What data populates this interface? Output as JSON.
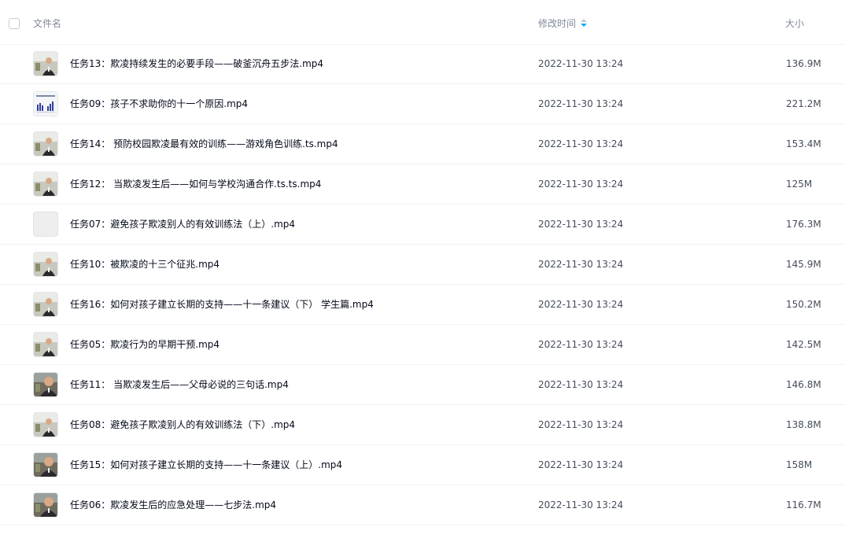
{
  "header": {
    "name_label": "文件名",
    "time_label": "修改时间",
    "size_label": "大小"
  },
  "colors": {
    "sort_active": "#06a7ff",
    "row_divider": "#f1f2f4",
    "header_text": "#818999"
  },
  "files": [
    {
      "name": "任务13：欺凌持续发生的必要手段——破釜沉舟五步法.mp4",
      "modified": "2022-11-30 13:24",
      "size": "136.9M",
      "thumb": "person-video-thumbnail"
    },
    {
      "name": "任务09：孩子不求助你的十一个原因.mp4",
      "modified": "2022-11-30 13:24",
      "size": "221.2M",
      "thumb": "bar-chart-video-thumbnail"
    },
    {
      "name": "任务14： 预防校园欺凌最有效的训练——游戏角色训练.ts.mp4",
      "modified": "2022-11-30 13:24",
      "size": "153.4M",
      "thumb": "person-video-thumbnail"
    },
    {
      "name": "任务12： 当欺凌发生后——如何与学校沟通合作.ts.ts.mp4",
      "modified": "2022-11-30 13:24",
      "size": "125M",
      "thumb": "person-video-thumbnail"
    },
    {
      "name": "任务07：避免孩子欺凌别人的有效训练法（上）.mp4",
      "modified": "2022-11-30 13:24",
      "size": "176.3M",
      "thumb": "blank-video-thumbnail"
    },
    {
      "name": "任务10：被欺凌的十三个征兆.mp4",
      "modified": "2022-11-30 13:24",
      "size": "145.9M",
      "thumb": "person-video-thumbnail"
    },
    {
      "name": "任务16：如何对孩子建立长期的支持——十一条建议（下） 学生篇.mp4",
      "modified": "2022-11-30 13:24",
      "size": "150.2M",
      "thumb": "person-video-thumbnail"
    },
    {
      "name": "任务05：欺凌行为的早期干预.mp4",
      "modified": "2022-11-30 13:24",
      "size": "142.5M",
      "thumb": "person-video-thumbnail"
    },
    {
      "name": "任务11： 当欺凌发生后——父母必说的三句话.mp4",
      "modified": "2022-11-30 13:24",
      "size": "146.8M",
      "thumb": "person-closeup-video-thumbnail"
    },
    {
      "name": "任务08：避免孩子欺凌别人的有效训练法（下）.mp4",
      "modified": "2022-11-30 13:24",
      "size": "138.8M",
      "thumb": "person-video-thumbnail"
    },
    {
      "name": "任务15：如何对孩子建立长期的支持——十一条建议（上）.mp4",
      "modified": "2022-11-30 13:24",
      "size": "158M",
      "thumb": "person-closeup-video-thumbnail"
    },
    {
      "name": "任务06：欺凌发生后的应急处理——七步法.mp4",
      "modified": "2022-11-30 13:24",
      "size": "116.7M",
      "thumb": "person-closeup-video-thumbnail"
    }
  ]
}
